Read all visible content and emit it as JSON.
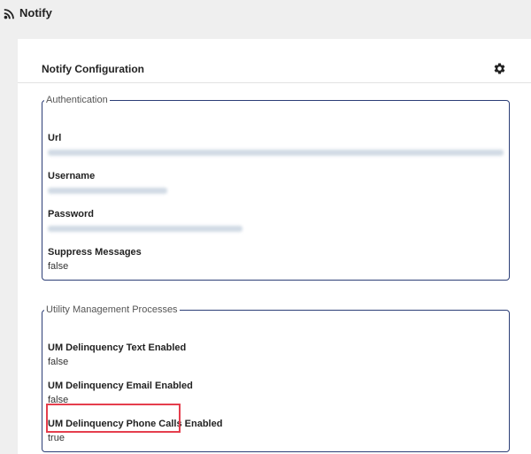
{
  "header": {
    "app_title": "Notify",
    "icon": "rss-icon"
  },
  "card": {
    "title": "Notify Configuration",
    "settings_icon": "gear-icon"
  },
  "authentication": {
    "legend": "Authentication",
    "fields": [
      {
        "label": "Url",
        "value_hidden": true
      },
      {
        "label": "Username",
        "value_hidden": true
      },
      {
        "label": "Password",
        "value_hidden": true
      },
      {
        "label": "Suppress Messages",
        "value": "false"
      }
    ]
  },
  "utility_processes": {
    "legend": "Utility Management Processes",
    "fields": [
      {
        "label": "UM Delinquency Text Enabled",
        "value": "false"
      },
      {
        "label": "UM Delinquency Email Enabled",
        "value": "false"
      },
      {
        "label": "UM Delinquency Phone Calls Enabled",
        "value": "true",
        "highlighted": true
      }
    ]
  },
  "colors": {
    "group_border": "#2c3e76",
    "highlight_border": "#e53e4d",
    "background": "#efefef"
  }
}
